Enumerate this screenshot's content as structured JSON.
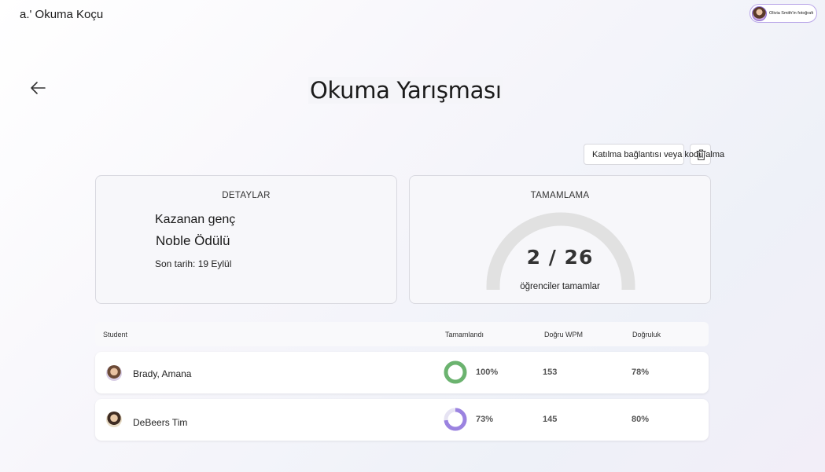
{
  "app": {
    "title": "a.' Okuma Koçu"
  },
  "profile": {
    "name": "Olivia Smith'in fotoğrafı"
  },
  "page": {
    "title": "Okuma Yarışması"
  },
  "toolbar": {
    "join_label": "Katılma bağlantısı veya kodu alma"
  },
  "details": {
    "header": "DETAYLAR",
    "prize_label": "Kazanan genç",
    "prize_name": "Noble Ödülü",
    "due_date": "Son tarih: 19 Eylül"
  },
  "completion": {
    "header": "TAMAMLAMA",
    "value_text": "2 / 26",
    "completed": 2,
    "total": 26,
    "caption": "öğrenciler tamamlar",
    "colors": {
      "track": "#e1e1e1",
      "fill": "#2b88d8"
    }
  },
  "table": {
    "columns": [
      "Student",
      "Tamamlandı",
      "Doğru WPM",
      "Doğruluk"
    ],
    "rows": [
      {
        "name": "Brady, Amana",
        "completed_pct": "100%",
        "completed_fraction": 1.0,
        "ring_color": "#6bb36f",
        "wpm": "153",
        "accuracy": "78%"
      },
      {
        "name": "DeBeers Tim",
        "completed_pct": "73%",
        "completed_fraction": 0.73,
        "ring_color": "#9b83e0",
        "wpm": "145",
        "accuracy": "80%"
      }
    ]
  }
}
